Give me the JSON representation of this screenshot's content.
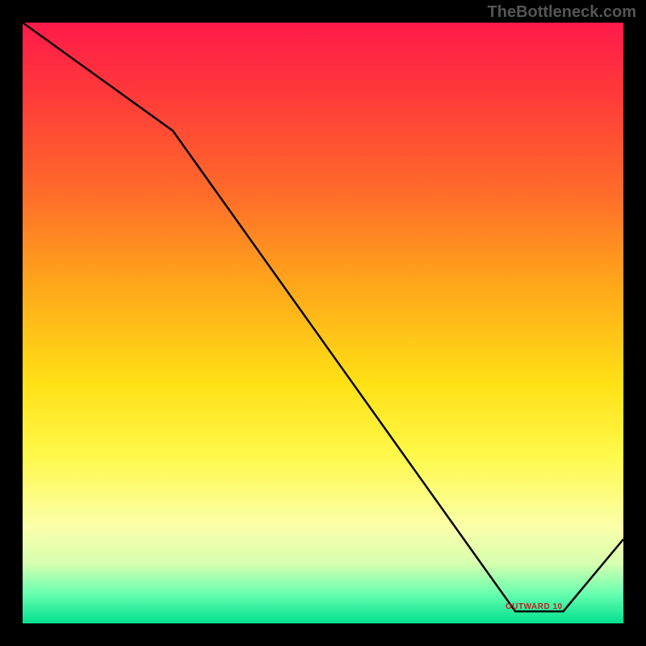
{
  "attribution": "TheBottleneck.com",
  "outward_label": "OUTWARD 10",
  "chart_data": {
    "type": "line",
    "title": "",
    "xlabel": "",
    "ylabel": "",
    "xlim": [
      0,
      100
    ],
    "ylim": [
      0,
      100
    ],
    "x": [
      0,
      25,
      82,
      90,
      100
    ],
    "values": [
      100,
      82,
      2,
      2,
      14
    ],
    "annotations": [
      {
        "text": "OUTWARD 10",
        "x": 86,
        "y": 2
      }
    ],
    "background_gradient": [
      {
        "pos": 0.0,
        "color": "#ff1a4a"
      },
      {
        "pos": 0.5,
        "color": "#ffd020"
      },
      {
        "pos": 0.85,
        "color": "#f8ff90"
      },
      {
        "pos": 1.0,
        "color": "#00e090"
      }
    ]
  }
}
